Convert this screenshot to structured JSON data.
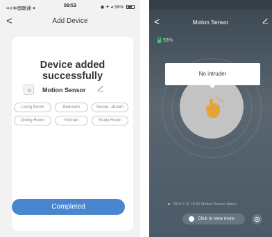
{
  "left": {
    "status": {
      "carrier": "••ıl 中国联通 ✦",
      "time": "09:53",
      "right": "◉ ✈ ◕ 58%"
    },
    "header": {
      "back": "<",
      "title": "Add Device"
    },
    "card": {
      "success_text": "Device added successfully",
      "device_name": "Motion Sensor",
      "rooms": [
        "Living Room",
        "Bedroom",
        "Secon...droom",
        "Dining Room",
        "Kitchen",
        "Study Room"
      ]
    },
    "complete_label": "Completed"
  },
  "right": {
    "header": {
      "back": "<",
      "title": "Motion Sensor"
    },
    "battery": "53%",
    "status_bubble": "No intruder",
    "alarm_log": "2019.7.11 15:26 Motion Sensor Alarm",
    "view_more_label": "Click to view more"
  },
  "colors": {
    "accent": "#4a86d0",
    "battery_green": "#3fcf6a",
    "hand_orange": "#e8a23a"
  },
  "icons": [
    "edit-icon",
    "back-icon",
    "battery-icon",
    "hand-icon",
    "settings-icon",
    "info-icon"
  ]
}
